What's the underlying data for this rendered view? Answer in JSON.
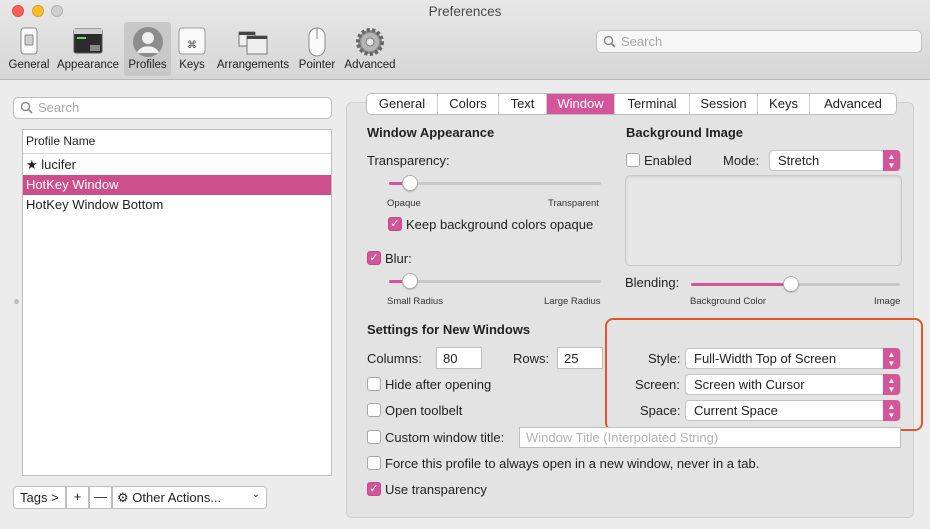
{
  "window": {
    "title": "Preferences"
  },
  "colors": {
    "accent": "#d3559a",
    "selection": "#cc4e8b",
    "highlight": "#e2552f"
  },
  "toolbar": {
    "items": [
      {
        "label": "General",
        "icon": "general-icon"
      },
      {
        "label": "Appearance",
        "icon": "appearance-icon"
      },
      {
        "label": "Profiles",
        "icon": "profiles-icon",
        "selected": true
      },
      {
        "label": "Keys",
        "icon": "keys-icon"
      },
      {
        "label": "Arrangements",
        "icon": "arrangements-icon"
      },
      {
        "label": "Pointer",
        "icon": "pointer-icon"
      },
      {
        "label": "Advanced",
        "icon": "gear-icon"
      }
    ],
    "search_placeholder": "Search"
  },
  "profiles": {
    "search_placeholder": "Search",
    "column_header": "Profile Name",
    "rows": [
      {
        "name": "★ lucifer"
      },
      {
        "name": "HotKey Window",
        "selected": true
      },
      {
        "name": "HotKey Window Bottom"
      }
    ],
    "bottom_bar": {
      "tags": "Tags >",
      "add": "+",
      "remove": "—",
      "other_actions": "Other Actions..."
    }
  },
  "tabs": {
    "items": [
      "General",
      "Colors",
      "Text",
      "Window",
      "Terminal",
      "Session",
      "Keys",
      "Advanced"
    ],
    "selected": "Window"
  },
  "window_appearance": {
    "title": "Window Appearance",
    "transparency_label": "Transparency:",
    "transparency_value": 0.1,
    "transparency_min": "Opaque",
    "transparency_max": "Transparent",
    "keep_bg_opaque_label": "Keep background colors opaque",
    "keep_bg_opaque": true,
    "blur_label": "Blur:",
    "blur": true,
    "blur_value": 0.1,
    "blur_min": "Small Radius",
    "blur_max": "Large Radius"
  },
  "background_image": {
    "title": "Background Image",
    "enabled_label": "Enabled",
    "enabled": false,
    "mode_label": "Mode:",
    "mode_value": "Stretch",
    "blending_label": "Blending:",
    "blending_value": 0.48,
    "blending_min": "Background Color",
    "blending_max": "Image"
  },
  "new_windows": {
    "title": "Settings for New Windows",
    "columns_label": "Columns:",
    "columns_value": "80",
    "rows_label": "Rows:",
    "rows_value": "25",
    "hide_after_opening": "Hide after opening",
    "open_toolbelt": "Open toolbelt",
    "custom_title_label": "Custom window title:",
    "custom_title_placeholder": "Window Title (Interpolated String)",
    "force_new_window": "Force this profile to always open in a new window, never in a tab.",
    "use_transparency": "Use transparency",
    "use_transparency_checked": true,
    "style_label": "Style:",
    "style_value": "Full-Width Top of Screen",
    "screen_label": "Screen:",
    "screen_value": "Screen with Cursor",
    "space_label": "Space:",
    "space_value": "Current Space"
  }
}
